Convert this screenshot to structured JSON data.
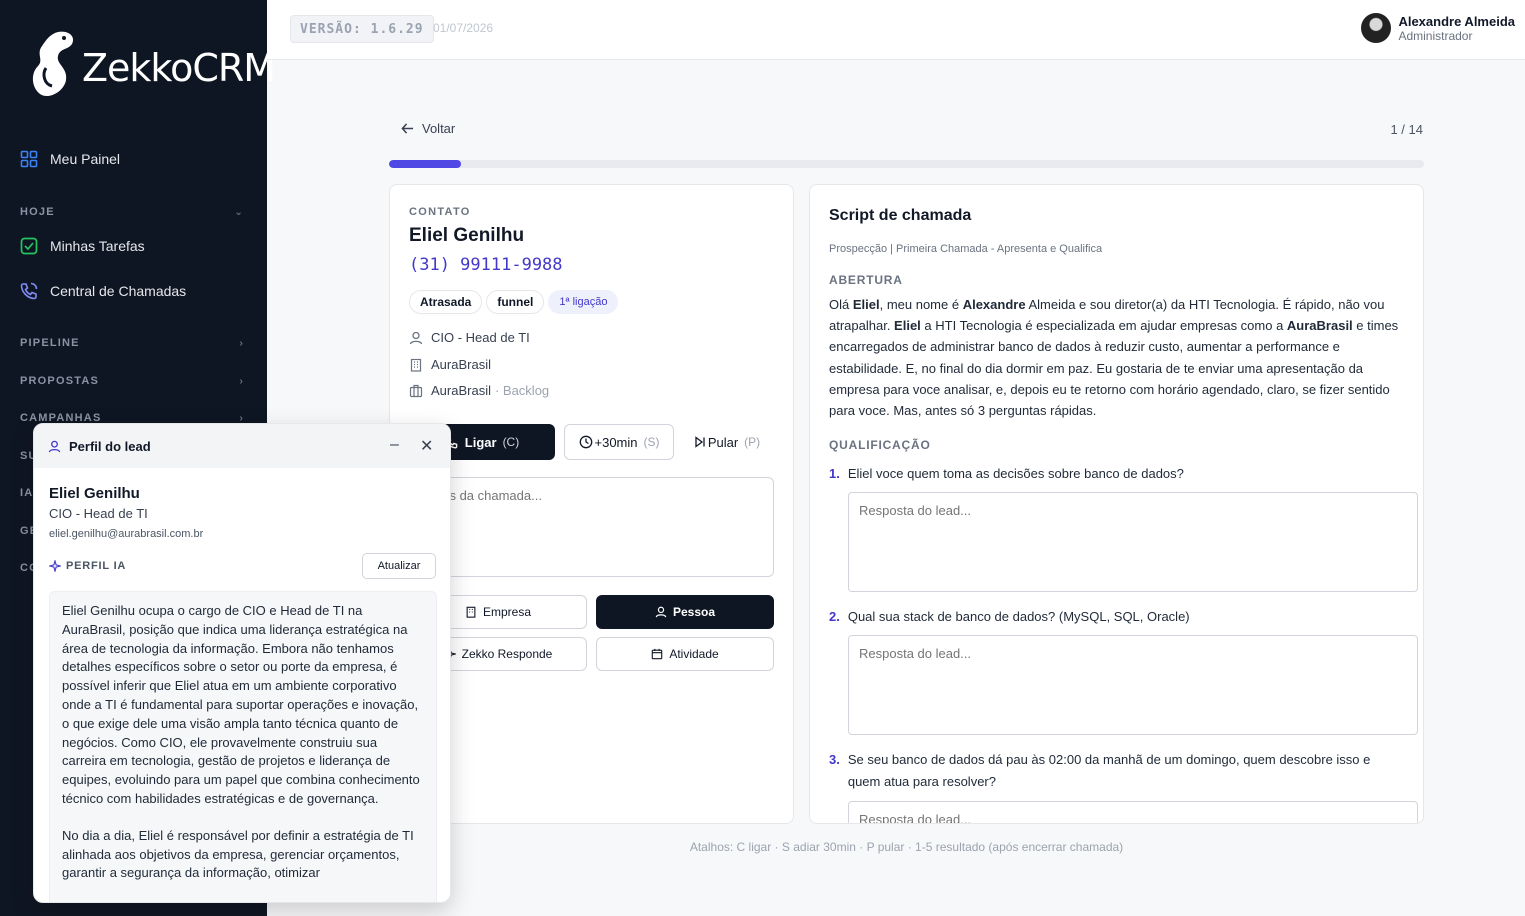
{
  "brand": {
    "name": "ZekkoCRM"
  },
  "sidebar": {
    "meu_painel": "Meu Painel",
    "sections": {
      "hoje": "HOJE",
      "pipeline": "PIPELINE",
      "propostas": "PROPOSTAS",
      "campanhas": "CAMPANHAS",
      "partial_su": "SU",
      "partial_ia": "IA",
      "partial_ge": "GE",
      "partial_co": "CO"
    },
    "minhas_tarefas": "Minhas Tarefas",
    "central_chamadas": "Central de Chamadas"
  },
  "header": {
    "version": "VERSÃO: 1.6.29",
    "date": "01/07/2026",
    "user_name": "Alexandre Almeida",
    "user_role": "Administrador"
  },
  "nav": {
    "back": "Voltar",
    "counter": "1 / 14",
    "progress_fraction": 0.07
  },
  "contact": {
    "overline": "CONTATO",
    "name": "Eliel Genilhu",
    "phone": "(31) 99111-9988",
    "chips": [
      "Atrasada",
      "funnel"
    ],
    "call_chip": "1ª ligação",
    "role": "CIO - Head de TI",
    "company": "AuraBrasil",
    "account": "AuraBrasil",
    "account_stage": "· Backlog",
    "call_btn": "Ligar",
    "call_key": "(C)",
    "snooze_btn": "+30min",
    "snooze_key": "(S)",
    "skip_btn": "Pular",
    "skip_key": "(P)",
    "notes_placeholder": "Notas da chamada...",
    "tab_empresa": "Empresa",
    "tab_pessoa": "Pessoa",
    "tab_zekko": "Zekko Responde",
    "tab_atividade": "Atividade"
  },
  "script": {
    "title": "Script de chamada",
    "subtitle": "Prospecção | Primeira Chamada - Apresenta e Qualifica",
    "abertura_label": "ABERTURA",
    "abertura": {
      "t1": "Olá ",
      "b1": "Eliel",
      "t2": ", meu nome é ",
      "b2": "Alexandre",
      "t3": " Almeida e sou diretor(a) da HTI Tecnologia. É rápido, não vou atrapalhar. ",
      "b3": "Eliel",
      "t4": " a HTI Tecnologia é especializada em ajudar empresas como a ",
      "b4": "AuraBrasil",
      "t5": " e times encarregados de administrar banco de dados à reduzir custo, aumentar a performance e estabilidade. E, no final do dia dormir em paz. Eu gostaria de te enviar uma apresentação da empresa para voce analisar, e, depois eu te retorno com horário agendado, claro, se fizer sentido para voce. Mas, antes só 3 perguntas rápidas."
    },
    "qualificacao_label": "QUALIFICAÇÃO",
    "questions": [
      {
        "num": "1.",
        "text": "Eliel voce quem toma as decisões sobre banco de dados?"
      },
      {
        "num": "2.",
        "text": "Qual sua stack de banco de dados? (MySQL, SQL, Oracle)"
      },
      {
        "num": "3.",
        "text": "Se seu banco de dados dá pau às 02:00 da manhã de um domingo, quem descobre isso e quem atua para resolver?"
      }
    ],
    "answer_placeholder": "Resposta do lead..."
  },
  "shortcuts": "Atalhos: C ligar · S adiar 30min · P pular · 1-5 resultado (após encerrar chamada)",
  "popup": {
    "title": "Perfil do lead",
    "name": "Eliel Genilhu",
    "role": "CIO - Head de TI",
    "email": "eliel.genilhu@aurabrasil.com.br",
    "ia_label": "PERFIL IA",
    "update_btn": "Atualizar",
    "p1": "Eliel Genilhu ocupa o cargo de CIO e Head de TI na AuraBrasil, posição que indica uma liderança estratégica na área de tecnologia da informação. Embora não tenhamos detalhes específicos sobre o setor ou porte da empresa, é possível inferir que Eliel atua em um ambiente corporativo onde a TI é fundamental para suportar operações e inovação, o que exige dele uma visão ampla tanto técnica quanto de negócios. Como CIO, ele provavelmente construiu sua carreira em tecnologia, gestão de projetos e liderança de equipes, evoluindo para um papel que combina conhecimento técnico com habilidades estratégicas e de governança.",
    "p2": "No dia a dia, Eliel é responsável por definir a estratégia de TI alinhada aos objetivos da empresa, gerenciar orçamentos, garantir a segurança da informação, otimizar"
  },
  "colors": {
    "accent": "#4338ca",
    "sidebar": "#0f1623",
    "progress": "#5048e5"
  }
}
